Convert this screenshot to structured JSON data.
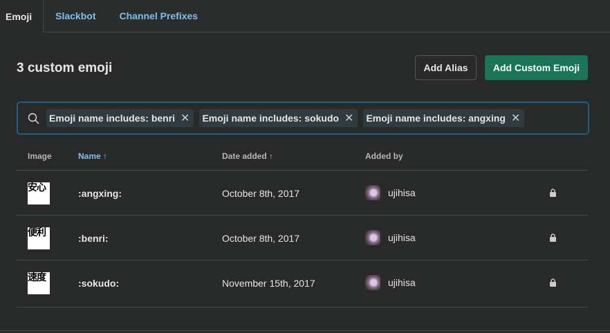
{
  "tabs": [
    "Emoji",
    "Slackbot",
    "Channel Prefixes"
  ],
  "title": "3 custom emoji",
  "buttons": {
    "alias": "Add Alias",
    "add": "Add Custom Emoji"
  },
  "filters": [
    "Emoji name includes: benri",
    "Emoji name includes: sokudo",
    "Emoji name includes: angxing"
  ],
  "columns": {
    "image": "Image",
    "name": "Name ↑",
    "date": "Date added ↑",
    "by": "Added by"
  },
  "rows": [
    {
      "glyph": "安心",
      "name": ":angxing:",
      "date": "October 8th, 2017",
      "by": "ujihisa"
    },
    {
      "glyph": "便利",
      "name": ":benri:",
      "date": "October 8th, 2017",
      "by": "ujihisa"
    },
    {
      "glyph": "速度",
      "name": ":sokudo:",
      "date": "November 15th, 2017",
      "by": "ujihisa"
    }
  ]
}
